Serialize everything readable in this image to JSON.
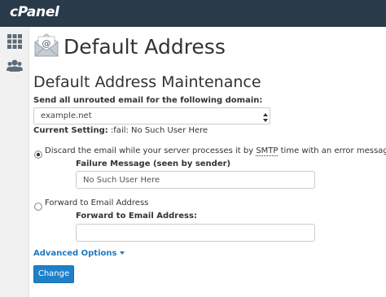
{
  "app": {
    "logo_text": "cPanel"
  },
  "sidebar": {
    "items": [
      {
        "icon": "grid-icon"
      },
      {
        "icon": "users-icon"
      }
    ]
  },
  "page": {
    "title": "Default Address",
    "icon": "email-envelope-icon"
  },
  "section": {
    "title": "Default Address Maintenance",
    "domain_label": "Send all unrouted email for the following domain:",
    "domain_selected": "example.net",
    "current_setting_label": "Current Setting:",
    "current_setting_value": ":fail: No Such User Here"
  },
  "options": {
    "discard": {
      "label_before": "Discard the email while your server processes it by",
      "label_abbr": "SMTP",
      "label_after": "time with an error message.",
      "selected": true,
      "failure_label": "Failure Message (seen by sender)",
      "failure_value": "No Such User Here"
    },
    "forward": {
      "label": "Forward to Email Address",
      "selected": false,
      "field_label": "Forward to Email Address:",
      "field_value": ""
    }
  },
  "advanced_label": "Advanced Options",
  "submit_label": "Change",
  "colors": {
    "topbar": "#293a4a",
    "accent": "#1f80c8",
    "link": "#1f78c1"
  }
}
